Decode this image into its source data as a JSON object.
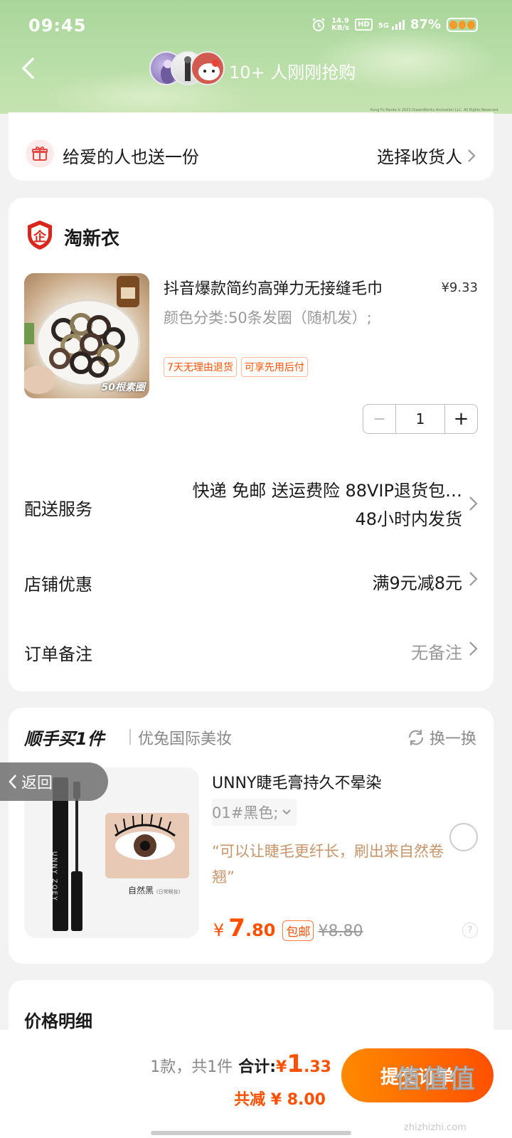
{
  "status": {
    "time": "09:45",
    "net_speed_value": "14.9",
    "net_speed_unit": "KB/s",
    "hd": "HD",
    "network": "5G",
    "battery": "87%"
  },
  "header": {
    "rush_text": "10+ 人刚刚抢购",
    "credit": "Kung Fu Panda & 2023 DreamWorks Animation LLC. All Rights Reserved."
  },
  "gift": {
    "label": "给爱的人也送一份",
    "action": "选择收货人"
  },
  "shop": {
    "name": "淘新衣",
    "product": {
      "title": "抖音爆款简约高弹力无接缝毛巾",
      "price": "¥9.33",
      "variant": "颜色分类:50条发圈（随机发）;",
      "image_caption": "50根素圈",
      "tags": [
        "7天无理由退货",
        "可享先用后付"
      ],
      "quantity": "1"
    },
    "delivery": {
      "label": "配送服务",
      "line1": "快递 免邮 送运费险 88VIP退货包…",
      "line2": "48小时内发货"
    },
    "discount": {
      "label": "店铺优惠",
      "value": "满9元减8元"
    },
    "note": {
      "label": "订单备注",
      "value": "无备注"
    }
  },
  "recommend": {
    "title": "顺手买1件",
    "shop": "优兔国际美妆",
    "refresh_label": "换一换",
    "product_name": "UNNY睫毛膏持久不晕染",
    "spec": "01#黑色;",
    "quote": "“可以让睫毛更纤长，刷出来自然卷翘”",
    "image_caption": "自然黑",
    "image_caption_sub": "(日常眼妆)",
    "brand_print": "UNNY ZOEY",
    "price_currency": "¥",
    "price_int": "7",
    "price_dec": ".80",
    "free_shipping": "包邮",
    "original_price": "¥8.80"
  },
  "float_back": "返回",
  "price_detail": {
    "title": "价格明细"
  },
  "footer": {
    "count": "1款，共1件",
    "total_label": "合计:",
    "total_currency": "¥",
    "total_int": "1",
    "total_dec": ".33",
    "saved": "共减 ¥ 8.00",
    "submit": "提交订单"
  },
  "watermark": {
    "text": "值值值",
    "url": "zhizhizhi.com"
  },
  "colors": {
    "accent": "#ff5000",
    "accent_light": "#ff8a00",
    "quote": "#c8956a",
    "header_green": "#b6dda6"
  }
}
